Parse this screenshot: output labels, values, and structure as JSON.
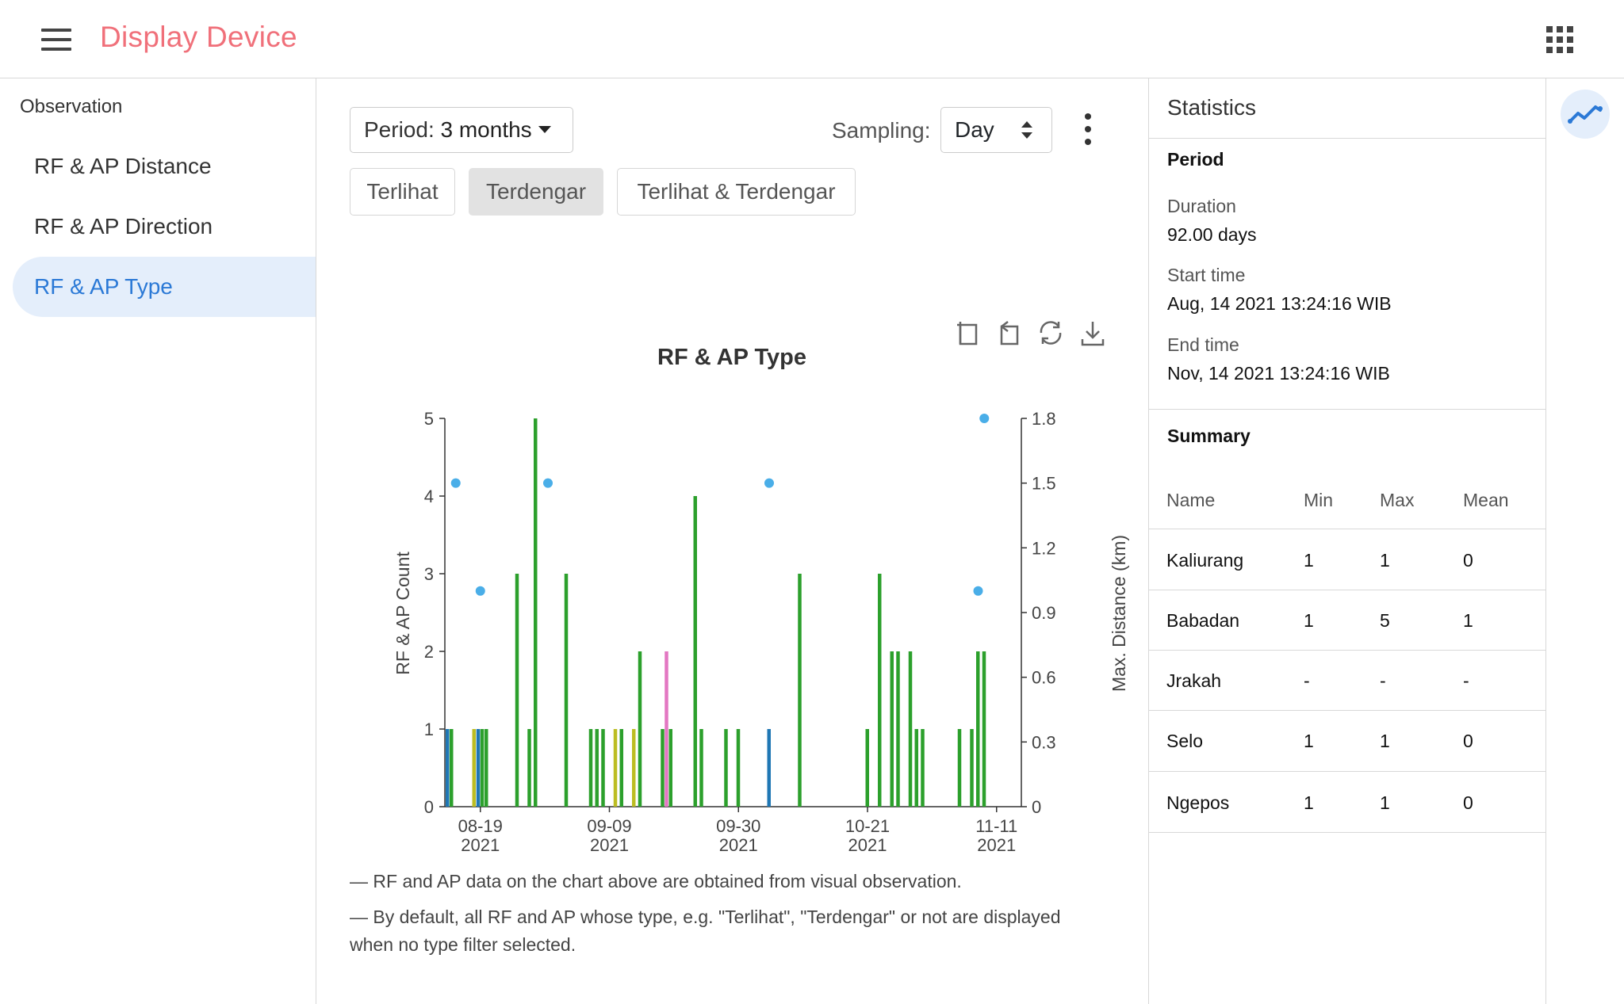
{
  "header": {
    "title": "Display Device"
  },
  "sidebar": {
    "section": "Observation",
    "items": [
      {
        "label": "RF & AP Distance",
        "active": false
      },
      {
        "label": "RF & AP Direction",
        "active": false
      },
      {
        "label": "RF & AP Type",
        "active": true
      }
    ]
  },
  "toolbar": {
    "period_label": "Period:",
    "period_value": "3 months",
    "sampling_label": "Sampling:",
    "sampling_value": "Day",
    "type_filters": [
      {
        "label": "Terlihat",
        "selected": false
      },
      {
        "label": "Terdengar",
        "selected": true
      },
      {
        "label": "Terlihat & Terdengar",
        "selected": false
      }
    ]
  },
  "chart_icons": [
    "zoom-icon",
    "zoom-reset-icon",
    "restore-icon",
    "download-icon"
  ],
  "chart_data": {
    "type": "bar",
    "title": "RF & AP Type",
    "ylabel": "RF & AP Count",
    "y2label": "Max. Distance (km)",
    "ylim": [
      0,
      5
    ],
    "y2lim": [
      0,
      1.8
    ],
    "yticks": [
      "0",
      "1",
      "2",
      "3",
      "4",
      "5"
    ],
    "y2ticks": [
      "0",
      "0.3",
      "0.6",
      "0.9",
      "1.2",
      "1.5",
      "1.8"
    ],
    "xticks": [
      {
        "date": "2021-08-19",
        "label1": "08-19",
        "label2": "2021"
      },
      {
        "date": "2021-09-09",
        "label1": "09-09",
        "label2": "2021"
      },
      {
        "date": "2021-09-30",
        "label1": "09-30",
        "label2": "2021"
      },
      {
        "date": "2021-10-21",
        "label1": "10-21",
        "label2": "2021"
      },
      {
        "date": "2021-11-11",
        "label1": "11-11",
        "label2": "2021"
      }
    ],
    "grid": false,
    "legend_position": "bottom",
    "series": [
      {
        "name": "Kaliurang",
        "color": "#1f77b4",
        "points": [
          [
            "2021-08-14",
            1
          ],
          [
            "2021-08-19",
            1
          ],
          [
            "2021-10-05",
            1
          ]
        ]
      },
      {
        "name": "Babadan",
        "color": "#2ca02c",
        "points": [
          [
            "2021-08-14",
            1
          ],
          [
            "2021-08-19",
            1
          ],
          [
            "2021-08-20",
            1
          ],
          [
            "2021-08-25",
            3
          ],
          [
            "2021-08-27",
            1
          ],
          [
            "2021-08-28",
            5
          ],
          [
            "2021-09-02",
            3
          ],
          [
            "2021-09-06",
            1
          ],
          [
            "2021-09-07",
            1
          ],
          [
            "2021-09-08",
            1
          ],
          [
            "2021-09-11",
            1
          ],
          [
            "2021-09-14",
            2
          ],
          [
            "2021-09-18",
            1
          ],
          [
            "2021-09-19",
            1
          ],
          [
            "2021-09-23",
            4
          ],
          [
            "2021-09-24",
            1
          ],
          [
            "2021-09-28",
            1
          ],
          [
            "2021-09-30",
            1
          ],
          [
            "2021-10-10",
            3
          ],
          [
            "2021-10-21",
            1
          ],
          [
            "2021-10-23",
            3
          ],
          [
            "2021-10-25",
            2
          ],
          [
            "2021-10-26",
            2
          ],
          [
            "2021-10-28",
            2
          ],
          [
            "2021-10-29",
            1
          ],
          [
            "2021-10-30",
            1
          ],
          [
            "2021-11-05",
            1
          ],
          [
            "2021-11-07",
            1
          ],
          [
            "2021-11-08",
            2
          ],
          [
            "2021-11-09",
            2
          ]
        ]
      },
      {
        "name": "Jrakah",
        "color": "#9467bd",
        "points": []
      },
      {
        "name": "Selo",
        "color": "#e377c2",
        "points": [
          [
            "2021-09-18",
            2
          ]
        ]
      },
      {
        "name": "Ngepos",
        "color": "#bcbd22",
        "points": [
          [
            "2021-08-18",
            1
          ],
          [
            "2021-09-10",
            1
          ],
          [
            "2021-09-13",
            1
          ]
        ]
      }
    ],
    "scatter_series": {
      "name": "Max. Distance",
      "color": "#4aaee8",
      "points": [
        [
          "2021-08-15",
          1.5
        ],
        [
          "2021-08-19",
          1.0
        ],
        [
          "2021-08-30",
          1.5
        ],
        [
          "2021-10-05",
          1.5
        ],
        [
          "2021-11-08",
          1.0
        ],
        [
          "2021-11-09",
          1.8
        ]
      ]
    },
    "x_domain": [
      "2021-08-14",
      "2021-11-14"
    ]
  },
  "notes": [
    "— RF and AP data on the chart above are obtained from visual observation.",
    "— By default, all RF and AP whose type, e.g. \"Terlihat\", \"Terdengar\" or not are displayed when no type filter selected."
  ],
  "statistics": {
    "title": "Statistics",
    "period_heading": "Period",
    "duration_label": "Duration",
    "duration_value": "92.00 days",
    "start_label": "Start time",
    "start_value": "Aug, 14 2021 13:24:16 WIB",
    "end_label": "End time",
    "end_value": "Nov, 14 2021 13:24:16 WIB",
    "summary_heading": "Summary",
    "columns": [
      "Name",
      "Min",
      "Max",
      "Mean"
    ],
    "rows": [
      [
        "Kaliurang",
        "1",
        "1",
        "0"
      ],
      [
        "Babadan",
        "1",
        "5",
        "1"
      ],
      [
        "Jrakah",
        "-",
        "-",
        "-"
      ],
      [
        "Selo",
        "1",
        "1",
        "0"
      ],
      [
        "Ngepos",
        "1",
        "1",
        "0"
      ]
    ]
  },
  "colors": {
    "accent": "#2b79d6",
    "brand": "#f0707a"
  }
}
